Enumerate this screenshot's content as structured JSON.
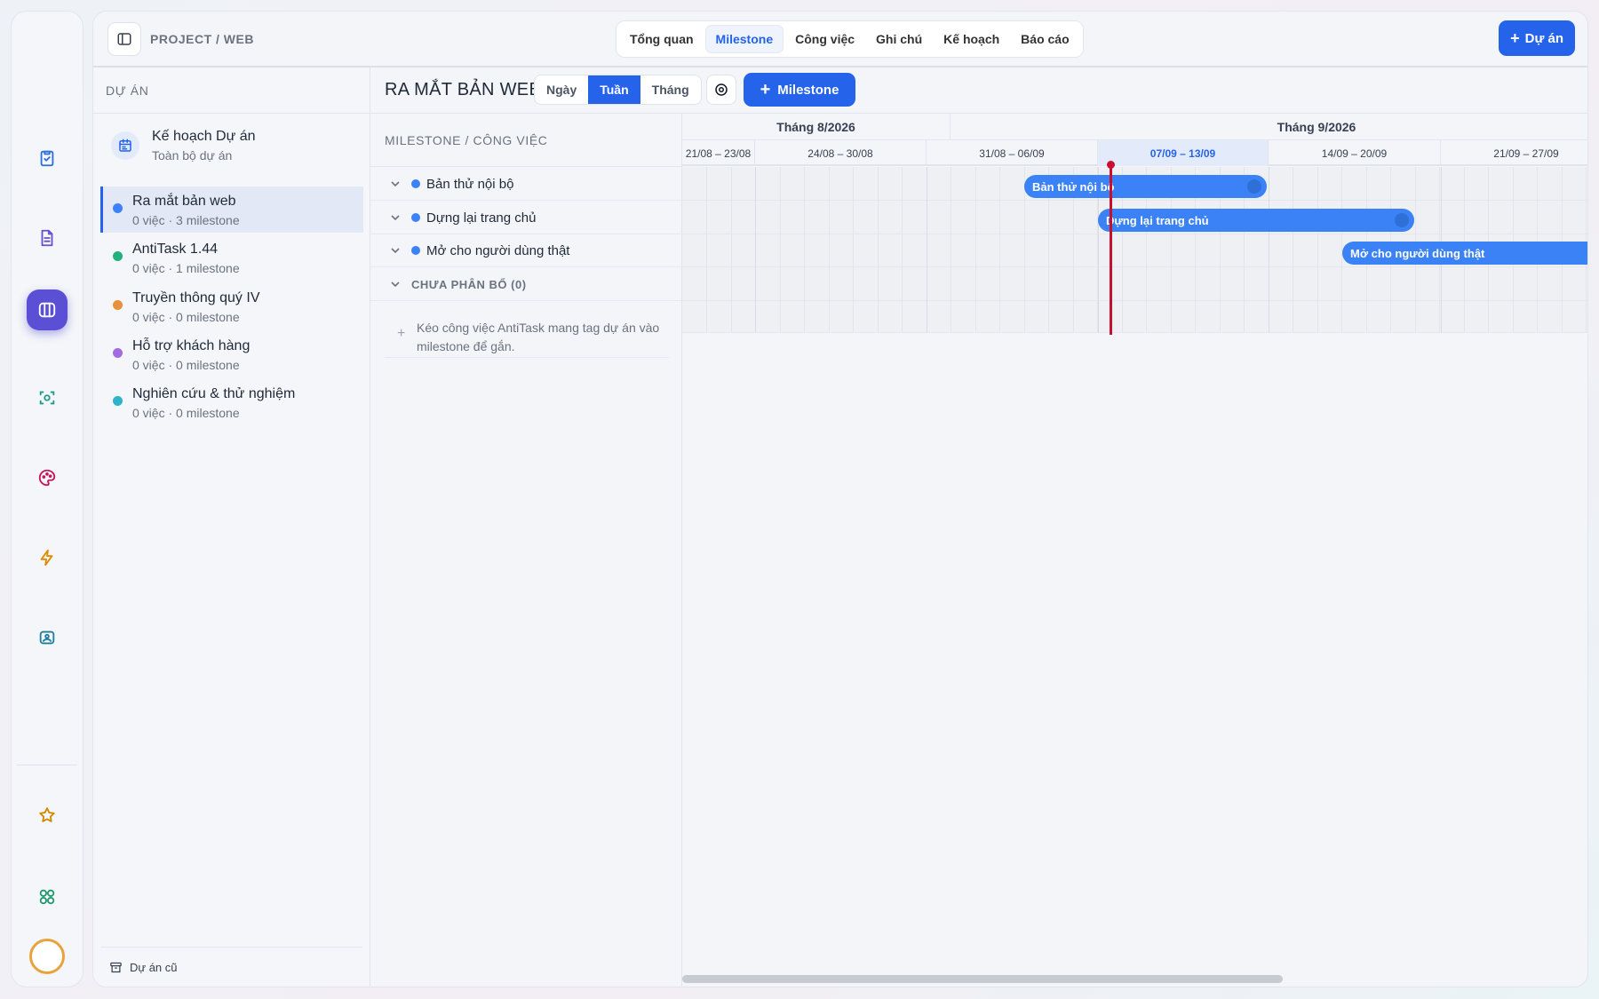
{
  "topbar": {
    "breadcrumb": "PROJECT / WEB",
    "tabs": [
      "Tổng quan",
      "Milestone",
      "Công việc",
      "Ghi chú",
      "Kế hoạch",
      "Báo cáo"
    ],
    "active_tab": "Milestone",
    "new_project_label": "Dự án"
  },
  "sidebar": {
    "header": "DỰ ÁN",
    "plan": {
      "title": "Kế hoạch Dự án",
      "subtitle": "Toàn bộ dự án"
    },
    "projects": [
      {
        "name": "Ra mắt bản web",
        "meta": "0 việc · 3 milestone",
        "color": "#3b82f6",
        "active": true
      },
      {
        "name": "AntiTask 1.44",
        "meta": "0 việc · 1 milestone",
        "color": "#22b07d"
      },
      {
        "name": "Truyền thông quý IV",
        "meta": "0 việc · 0 milestone",
        "color": "#e8903a"
      },
      {
        "name": "Hỗ trợ khách hàng",
        "meta": "0 việc · 0 milestone",
        "color": "#a36be0"
      },
      {
        "name": "Nghiên cứu & thử nghiệm",
        "meta": "0 việc · 0 milestone",
        "color": "#2fb3c8"
      }
    ],
    "archive_label": "Dự án cũ"
  },
  "content": {
    "title": "RA MẮT BẢN WEB",
    "views": [
      "Ngày",
      "Tuần",
      "Tháng"
    ],
    "active_view": "Tuần",
    "add_milestone_label": "Milestone",
    "column_header": "MILESTONE / CÔNG VIỆC",
    "milestones": [
      "Bản thử nội bộ",
      "Dựng lại trang chủ",
      "Mở cho người dùng thật"
    ],
    "unassigned_label": "CHƯA PHÂN BỔ (0)",
    "hint": "Kéo công việc AntiTask mang tag dự án vào milestone để gắn."
  },
  "timeline": {
    "months": [
      "Tháng 8/2026",
      "Tháng 9/2026"
    ],
    "weeks": [
      "21/08 – 23/08",
      "24/08 – 30/08",
      "31/08 – 06/09",
      "07/09 – 13/09",
      "14/09 – 20/09",
      "21/09 – 27/09"
    ],
    "current_week": "07/09 – 13/09",
    "bars": [
      "Bản thử nội bộ",
      "Dựng lại trang chủ",
      "Mở cho người dùng thật"
    ]
  },
  "colors": {
    "accent": "#2563eb",
    "bar": "#3b82f6",
    "today": "#c8102e",
    "rail_active": "#5b4fd6"
  },
  "rail_icons": [
    "clipboard-check-icon",
    "document-icon",
    "columns-icon",
    "scan-icon",
    "palette-icon",
    "lightning-icon",
    "image-icon",
    "star-icon",
    "grid-apps-icon"
  ]
}
